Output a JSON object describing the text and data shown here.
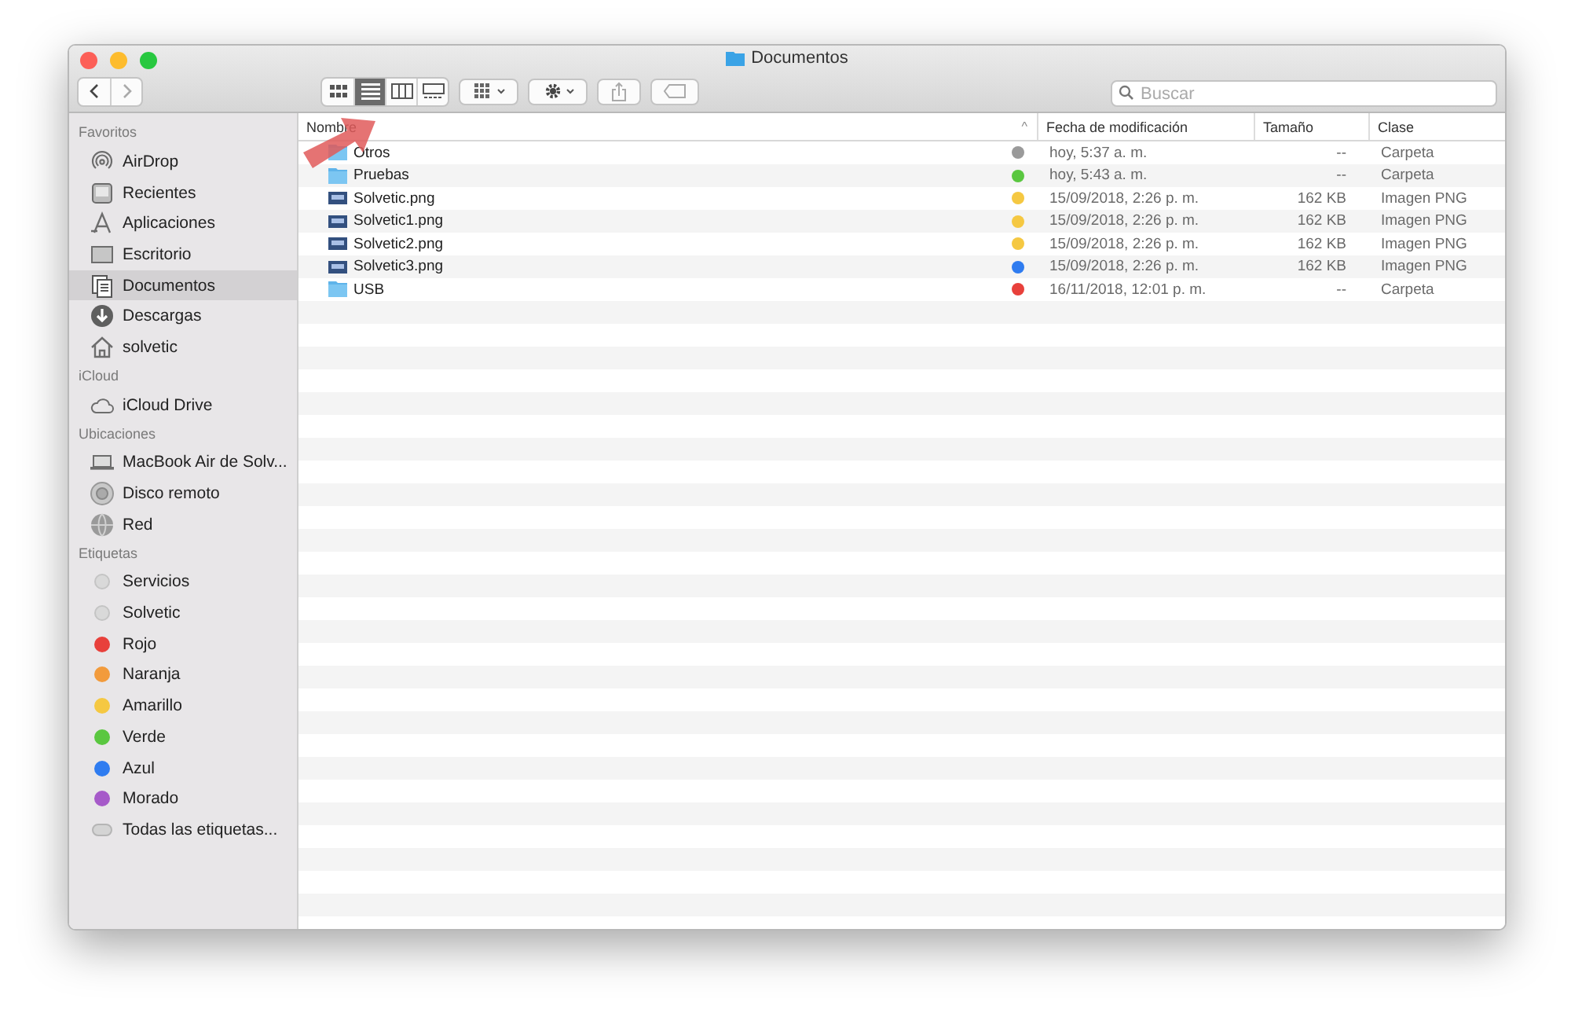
{
  "window": {
    "title": "Documentos"
  },
  "toolbar": {
    "views": [
      {
        "kind": "icons",
        "selected": false
      },
      {
        "kind": "list",
        "selected": true
      },
      {
        "kind": "columns",
        "selected": false
      },
      {
        "kind": "gallery",
        "selected": false
      }
    ],
    "search": {
      "placeholder": "Buscar"
    }
  },
  "sidebar": {
    "sections": [
      {
        "title": "Favoritos",
        "items": [
          {
            "label": "AirDrop",
            "kind": "airdrop",
            "selected": false
          },
          {
            "label": "Recientes",
            "kind": "recent",
            "selected": false
          },
          {
            "label": "Aplicaciones",
            "kind": "apps",
            "selected": false
          },
          {
            "label": "Escritorio",
            "kind": "desktop",
            "selected": false
          },
          {
            "label": "Documentos",
            "kind": "docs",
            "selected": true
          },
          {
            "label": "Descargas",
            "kind": "downloads",
            "selected": false
          },
          {
            "label": "solvetic",
            "kind": "home",
            "selected": false
          }
        ]
      },
      {
        "title": "iCloud",
        "items": [
          {
            "label": "iCloud Drive",
            "kind": "cloud",
            "selected": false
          }
        ]
      },
      {
        "title": "Ubicaciones",
        "items": [
          {
            "label": "MacBook Air de Solv...",
            "kind": "laptop",
            "selected": false
          },
          {
            "label": "Disco remoto",
            "kind": "disc",
            "selected": false
          },
          {
            "label": "Red",
            "kind": "network",
            "selected": false
          }
        ]
      },
      {
        "title": "Etiquetas",
        "items": [
          {
            "label": "Servicios",
            "kind": "tag",
            "color": "#d9d9d9",
            "selected": false
          },
          {
            "label": "Solvetic",
            "kind": "tag",
            "color": "#d9d9d9",
            "selected": false
          },
          {
            "label": "Rojo",
            "kind": "tag",
            "color": "#e8403b",
            "selected": false
          },
          {
            "label": "Naranja",
            "kind": "tag",
            "color": "#f29b3c",
            "selected": false
          },
          {
            "label": "Amarillo",
            "kind": "tag",
            "color": "#f5c842",
            "selected": false
          },
          {
            "label": "Verde",
            "kind": "tag",
            "color": "#5ac740",
            "selected": false
          },
          {
            "label": "Azul",
            "kind": "tag",
            "color": "#2f7cf0",
            "selected": false
          },
          {
            "label": "Morado",
            "kind": "tag",
            "color": "#a65ac9",
            "selected": false
          },
          {
            "label": "Todas las etiquetas...",
            "kind": "all-tags",
            "selected": false
          }
        ]
      }
    ]
  },
  "table": {
    "columns": [
      "Nombre",
      "Fecha de modificación",
      "Tamaño",
      "Clase"
    ],
    "sort_indicator": "^",
    "rows": [
      {
        "kind": "folder",
        "name": "Otros",
        "color": "#9a9a9a",
        "date": "hoy, 5:37 a. m.",
        "size": "--",
        "type": "Carpeta"
      },
      {
        "kind": "folder",
        "name": "Pruebas",
        "color": "#5ac740",
        "date": "hoy, 5:43 a. m.",
        "size": "--",
        "type": "Carpeta"
      },
      {
        "kind": "image",
        "name": "Solvetic.png",
        "color": "#f5c842",
        "date": "15/09/2018, 2:26 p. m.",
        "size": "162 KB",
        "type": "Imagen PNG"
      },
      {
        "kind": "image",
        "name": "Solvetic1.png",
        "color": "#f5c842",
        "date": "15/09/2018, 2:26 p. m.",
        "size": "162 KB",
        "type": "Imagen PNG"
      },
      {
        "kind": "image",
        "name": "Solvetic2.png",
        "color": "#f5c842",
        "date": "15/09/2018, 2:26 p. m.",
        "size": "162 KB",
        "type": "Imagen PNG"
      },
      {
        "kind": "image",
        "name": "Solvetic3.png",
        "color": "#2f7cf0",
        "date": "15/09/2018, 2:26 p. m.",
        "size": "162 KB",
        "type": "Imagen PNG"
      },
      {
        "kind": "folder",
        "name": "USB",
        "color": "#e8403b",
        "date": "16/11/2018, 12:01 p. m.",
        "size": "--",
        "type": "Carpeta"
      }
    ]
  }
}
